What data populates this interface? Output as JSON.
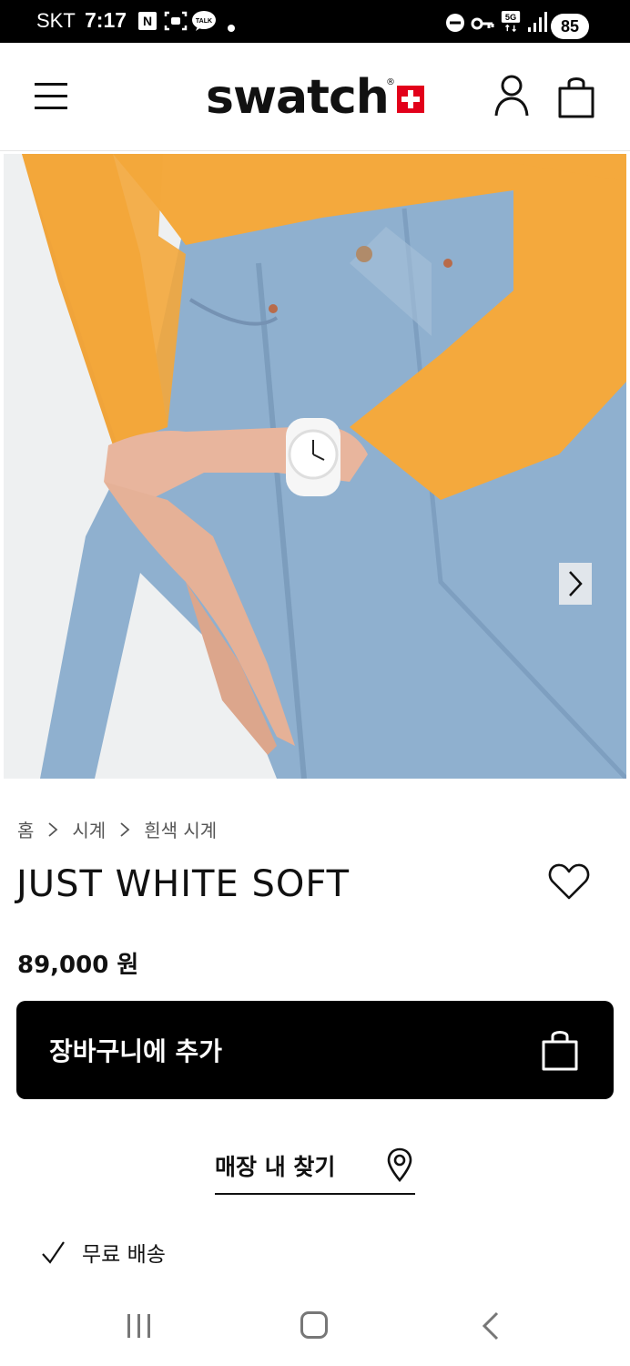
{
  "status_bar": {
    "carrier": "SKT",
    "time": "7:17",
    "n_badge": "N",
    "talk_badge": "TALK",
    "network": "5G",
    "battery": "85"
  },
  "header": {
    "logo_text": "swatch",
    "logo_reg": "®"
  },
  "breadcrumb": {
    "items": [
      "홈",
      "시계",
      "흰색 시계"
    ]
  },
  "product": {
    "title": "JUST WHITE SOFT",
    "price": "89,000 원"
  },
  "actions": {
    "add_to_cart": "장바구니에 추가",
    "find_store": "매장 내 찾기"
  },
  "benefits": {
    "shipping": "무료 배송"
  },
  "colors": {
    "brand_red": "#e2001a",
    "sweater": "#f4a93d",
    "denim": "#8fb0cf"
  }
}
